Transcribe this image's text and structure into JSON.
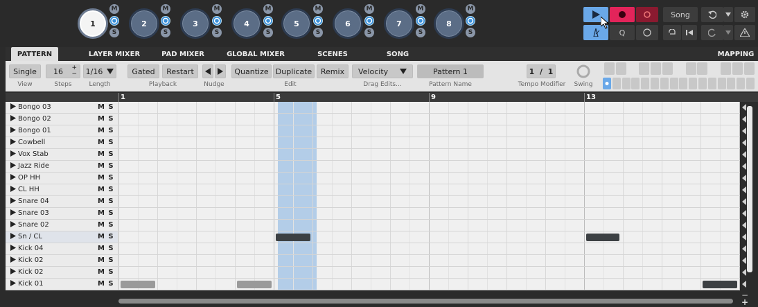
{
  "pads": [
    {
      "label": "1",
      "active": true
    },
    {
      "label": "2",
      "active": false
    },
    {
      "label": "3",
      "active": false
    },
    {
      "label": "4",
      "active": false
    },
    {
      "label": "5",
      "active": false
    },
    {
      "label": "6",
      "active": false
    },
    {
      "label": "7",
      "active": false
    },
    {
      "label": "8",
      "active": false
    }
  ],
  "pad_buttons": {
    "mute": "M",
    "solo": "S"
  },
  "transport": {
    "song_label": "Song",
    "q_label": "Q"
  },
  "tabs": [
    {
      "label": "PATTERN",
      "active": true
    },
    {
      "label": "LAYER MIXER"
    },
    {
      "label": "PAD MIXER"
    },
    {
      "label": "GLOBAL MIXER"
    },
    {
      "label": "SCENES"
    },
    {
      "label": "SONG"
    },
    {
      "label": "MAPPING"
    }
  ],
  "controls": {
    "view": {
      "value": "Single",
      "label": "View"
    },
    "steps": {
      "value": "16",
      "label": "Steps"
    },
    "length": {
      "value": "1/16",
      "label": "Length"
    },
    "playback": {
      "gated": "Gated",
      "restart": "Restart",
      "label": "Playback"
    },
    "nudge": {
      "label": "Nudge"
    },
    "edit": {
      "quantize": "Quantize",
      "duplicate": "Duplicate",
      "remix": "Remix",
      "label": "Edit"
    },
    "drag_edits": {
      "value": "Velocity",
      "label": "Drag Edits..."
    },
    "pattern_name": {
      "value": "Pattern 1",
      "label": "Pattern Name"
    },
    "tempo_modifier": {
      "value": "1  /  1",
      "label": "Tempo Modifier"
    },
    "swing": {
      "label": "Swing"
    }
  },
  "ruler": [
    "1",
    "5",
    "9",
    "13"
  ],
  "tracks": [
    {
      "name": "Bongo 03",
      "ms": "M S"
    },
    {
      "name": "Bongo 02",
      "ms": "M S"
    },
    {
      "name": "Bongo 01",
      "ms": "M S"
    },
    {
      "name": "Cowbell",
      "ms": "M S"
    },
    {
      "name": "Vox Stab",
      "ms": "M S"
    },
    {
      "name": "Jazz Ride",
      "ms": "M S"
    },
    {
      "name": "OP HH",
      "ms": "M S"
    },
    {
      "name": "CL HH",
      "ms": "M S"
    },
    {
      "name": "Snare 04",
      "ms": "M S"
    },
    {
      "name": "Snare 03",
      "ms": "M S"
    },
    {
      "name": "Snare 02",
      "ms": "M S"
    },
    {
      "name": "Sn / CL",
      "ms": "M S",
      "selected": true
    },
    {
      "name": "Kick 04",
      "ms": "M S"
    },
    {
      "name": "Kick 02",
      "ms": "M S"
    },
    {
      "name": "Kick 02",
      "ms": "M S"
    },
    {
      "name": "Kick 01",
      "ms": "M S"
    }
  ],
  "notes": [
    {
      "track": 11,
      "step": 5,
      "shade": "dark"
    },
    {
      "track": 11,
      "step": 13,
      "shade": "dark"
    },
    {
      "track": 15,
      "step": 1,
      "shade": "grey"
    },
    {
      "track": 15,
      "step": 4,
      "shade": "grey"
    },
    {
      "track": 15,
      "step": 16,
      "shade": "dark"
    }
  ],
  "colors": {
    "accent_blue": "#6aa8e8",
    "record_red": "#e3245a",
    "highlight_column": "#b3cde8"
  },
  "icons": [
    "play-icon",
    "record-icon",
    "overdub-icon",
    "metronome-icon",
    "undo-icon",
    "redo-icon",
    "settings-icon",
    "loop-icon",
    "rewind-icon",
    "warning-icon",
    "triangle-right-icon"
  ]
}
